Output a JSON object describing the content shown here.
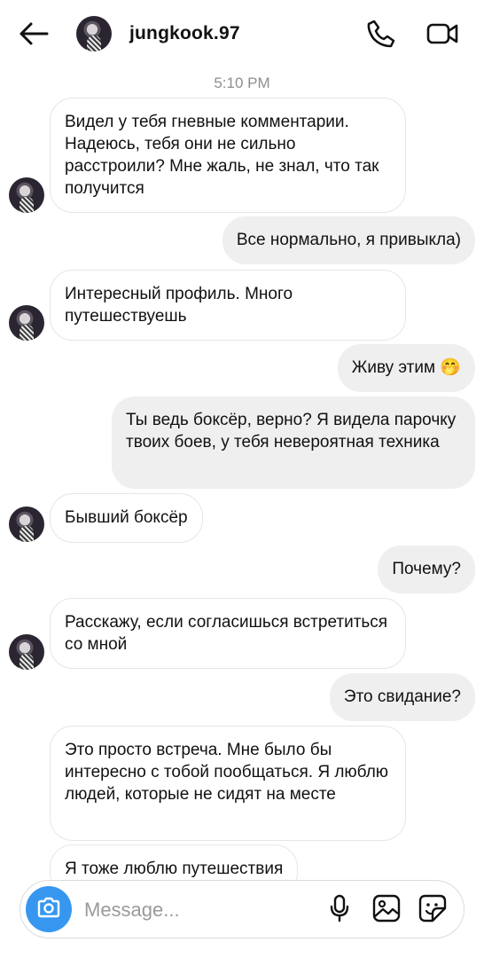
{
  "header": {
    "username": "jungkook.97",
    "icons": {
      "back": "arrow-left-icon",
      "call": "phone-icon",
      "video": "video-camera-icon"
    }
  },
  "thread": {
    "timestamp": "5:10 PM",
    "messages": [
      {
        "side": "in",
        "text": "Видел у тебя гневные комментарии. Надеюсь, тебя они не сильно расстроили? Мне жаль, не знал, что так получится"
      },
      {
        "side": "out",
        "text": "Все нормально, я привыкла)"
      },
      {
        "side": "in",
        "text": "Интересный профиль. Много путешествуешь"
      },
      {
        "side": "out",
        "text": "Живу этим 🤭"
      },
      {
        "side": "out",
        "text": "Ты ведь боксёр, верно? Я видела парочку твоих боев, у тебя невероятная техника"
      },
      {
        "side": "in",
        "text": "Бывший боксёр"
      },
      {
        "side": "out",
        "text": "Почему?"
      },
      {
        "side": "in",
        "text": "Расскажу, если согласишься встретиться со мной"
      },
      {
        "side": "out",
        "text": "Это свидание?"
      },
      {
        "side": "in",
        "text": "Это просто встреча. Мне было бы интересно с тобой пообщаться. Я люблю людей, которые не сидят на месте"
      },
      {
        "side": "in",
        "text": "Я тоже люблю путешествия"
      }
    ]
  },
  "composer": {
    "placeholder": "Message...",
    "value": "",
    "icons": {
      "camera": "camera-icon",
      "mic": "microphone-icon",
      "gallery": "image-gallery-icon",
      "sticker": "sticker-icon"
    },
    "accent_color": "#3797f0"
  }
}
